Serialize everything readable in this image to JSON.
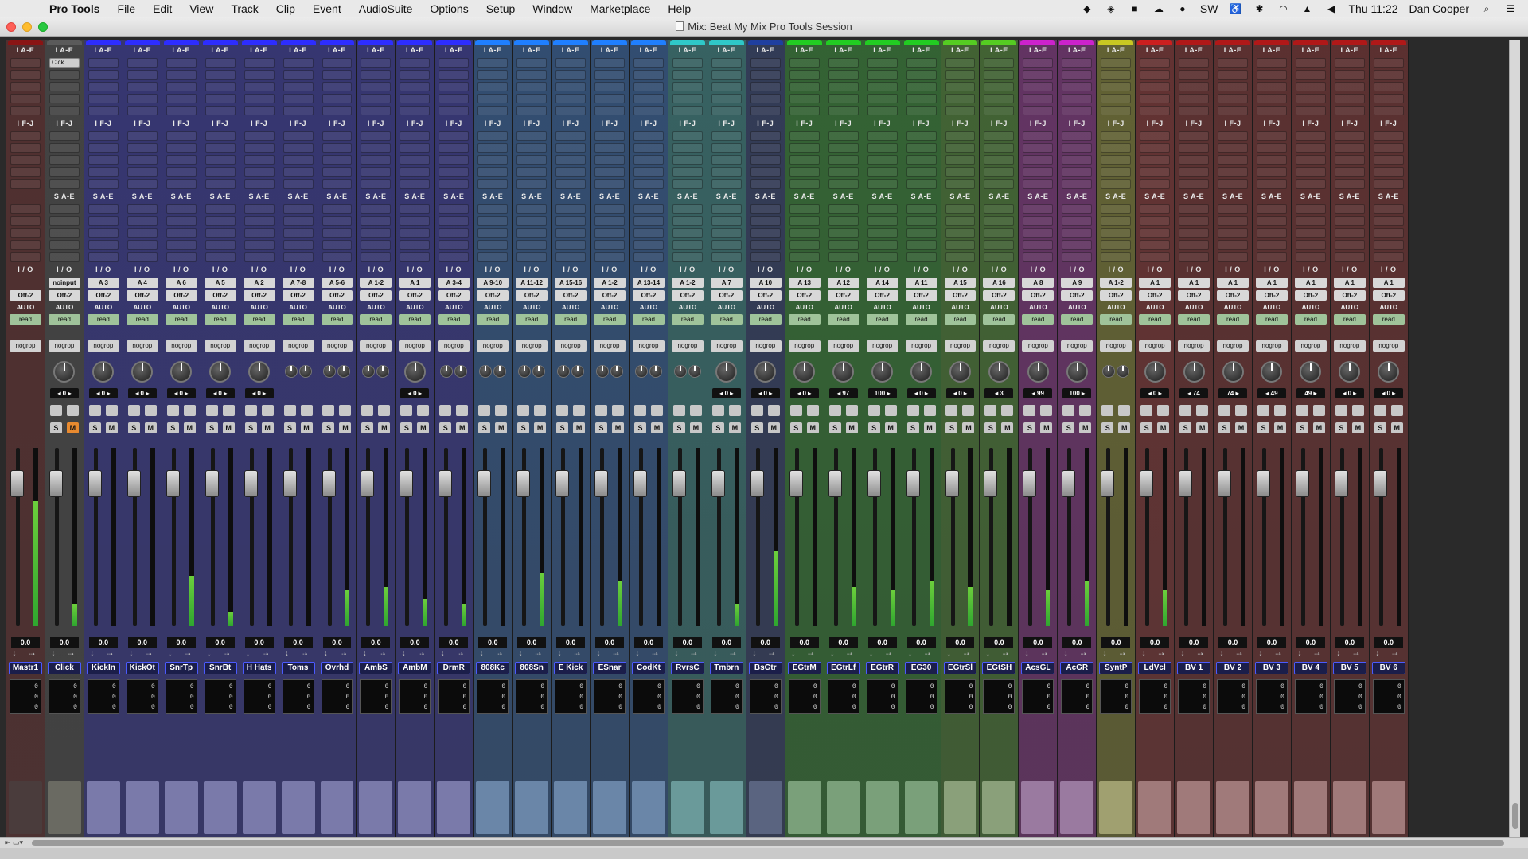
{
  "menubar": {
    "app": "Pro Tools",
    "items": [
      "File",
      "Edit",
      "View",
      "Track",
      "Clip",
      "Event",
      "AudioSuite",
      "Options",
      "Setup",
      "Window",
      "Marketplace",
      "Help"
    ],
    "status_text": "SW",
    "clock": "Thu 11:22",
    "user": "Dan Cooper"
  },
  "window": {
    "title": "Mix: Beat My Mix Pro Tools Session"
  },
  "labels": {
    "inserts_ae": "I A-E",
    "inserts_fj": "I F-J",
    "sends_ae": "S A-E",
    "io": "I / O",
    "output": "Ott-2",
    "auto": "AUTO",
    "read": "read",
    "group": "nogrop",
    "solo": "S",
    "mute": "M",
    "input": "I",
    "click_insert": "Clck",
    "counter_vals": "0"
  },
  "tracks": [
    {
      "name": "Mastr1",
      "color": "#8a1414",
      "io": "",
      "pan": "",
      "vol": "0.0",
      "meter": 0.7,
      "fader": 0.2,
      "comment": "#4a3c3c",
      "master": true
    },
    {
      "name": "Click",
      "color": "#5a5a5a",
      "io": "noinput",
      "pan": "◂ 0 ▸",
      "vol": "0.0",
      "meter": 0.12,
      "fader": 0.2,
      "comment": "#6a6a62",
      "mute_on": true
    },
    {
      "name": "KickIn",
      "color": "#2d2dff",
      "io": "A 3",
      "pan": "◂ 0 ▸",
      "vol": "0.0",
      "meter": 0.0,
      "fader": 0.2,
      "comment": "#7a7aaa"
    },
    {
      "name": "KickOt",
      "color": "#2d2dff",
      "io": "A 4",
      "pan": "◂ 0 ▸",
      "vol": "0.0",
      "meter": 0.0,
      "fader": 0.2,
      "comment": "#7a7aaa"
    },
    {
      "name": "SnrTp",
      "color": "#2d2dff",
      "io": "A 6",
      "pan": "◂ 0 ▸",
      "vol": "0.0",
      "meter": 0.28,
      "fader": 0.2,
      "comment": "#7a7aaa"
    },
    {
      "name": "SnrBt",
      "color": "#2d2dff",
      "io": "A 5",
      "pan": "◂ 0 ▸",
      "vol": "0.0",
      "meter": 0.08,
      "fader": 0.2,
      "comment": "#7a7aaa"
    },
    {
      "name": "H Hats",
      "color": "#2d2dff",
      "io": "A 2",
      "pan": "◂ 0 ▸",
      "vol": "0.0",
      "meter": 0.0,
      "fader": 0.2,
      "comment": "#7a7aaa"
    },
    {
      "name": "Toms",
      "color": "#2d2dff",
      "io": "A 7-8",
      "pan": "",
      "vol": "0.0",
      "meter": 0.0,
      "fader": 0.2,
      "comment": "#7a7aaa",
      "stereo": true
    },
    {
      "name": "Ovrhd",
      "color": "#2d2dff",
      "io": "A 5-6",
      "pan": "",
      "vol": "0.0",
      "meter": 0.2,
      "fader": 0.2,
      "comment": "#7a7aaa",
      "stereo": true
    },
    {
      "name": "AmbS",
      "color": "#2d2dff",
      "io": "A 1-2",
      "pan": "",
      "vol": "0.0",
      "meter": 0.22,
      "fader": 0.2,
      "comment": "#7a7aaa",
      "stereo": true
    },
    {
      "name": "AmbM",
      "color": "#2d2dff",
      "io": "A 1",
      "pan": "◂ 0 ▸",
      "vol": "0.0",
      "meter": 0.15,
      "fader": 0.2,
      "comment": "#7a7aaa"
    },
    {
      "name": "DrmR",
      "color": "#2d2dff",
      "io": "A 3-4",
      "pan": "",
      "vol": "0.0",
      "meter": 0.12,
      "fader": 0.2,
      "comment": "#7a7aaa",
      "stereo": true
    },
    {
      "name": "808Kc",
      "color": "#1f7fff",
      "io": "A 9-10",
      "pan": "",
      "vol": "0.0",
      "meter": 0.0,
      "fader": 0.2,
      "comment": "#6a86a8",
      "stereo": true
    },
    {
      "name": "808Sn",
      "color": "#1f7fff",
      "io": "A 11-12",
      "pan": "",
      "vol": "0.0",
      "meter": 0.3,
      "fader": 0.2,
      "comment": "#6a86a8",
      "stereo": true
    },
    {
      "name": "E Kick",
      "color": "#1f7fff",
      "io": "A 15-16",
      "pan": "",
      "vol": "0.0",
      "meter": 0.0,
      "fader": 0.2,
      "comment": "#6a86a8",
      "stereo": true
    },
    {
      "name": "ESnar",
      "color": "#1f7fff",
      "io": "A 1-2",
      "pan": "",
      "vol": "0.0",
      "meter": 0.25,
      "fader": 0.2,
      "comment": "#6a86a8",
      "stereo": true
    },
    {
      "name": "CodKt",
      "color": "#1f7fff",
      "io": "A 13-14",
      "pan": "",
      "vol": "0.0",
      "meter": 0.0,
      "fader": 0.2,
      "comment": "#6a86a8",
      "stereo": true
    },
    {
      "name": "RvrsC",
      "color": "#2fc8c8",
      "io": "A 1-2",
      "pan": "",
      "vol": "0.0",
      "meter": 0.0,
      "fader": 0.2,
      "comment": "#6a9a9a",
      "stereo": true
    },
    {
      "name": "Tmbrn",
      "color": "#2fc8c8",
      "io": "A 7",
      "pan": "◂ 0 ▸",
      "vol": "0.0",
      "meter": 0.12,
      "fader": 0.2,
      "comment": "#6a9a9a"
    },
    {
      "name": "BsGtr",
      "color": "#1f3f9f",
      "io": "A 10",
      "pan": "◂ 0 ▸",
      "vol": "0.0",
      "meter": 0.42,
      "fader": 0.2,
      "comment": "#5a6480"
    },
    {
      "name": "EGtrM",
      "color": "#22cc22",
      "io": "A 13",
      "pan": "◂ 0 ▸",
      "vol": "0.0",
      "meter": 0.0,
      "fader": 0.2,
      "comment": "#7aa07a"
    },
    {
      "name": "EGtrLf",
      "color": "#22cc22",
      "io": "A 12",
      "pan": "◂ 97",
      "vol": "0.0",
      "meter": 0.22,
      "fader": 0.2,
      "comment": "#7aa07a"
    },
    {
      "name": "EGtrR",
      "color": "#22cc22",
      "io": "A 14",
      "pan": "100 ▸",
      "vol": "0.0",
      "meter": 0.2,
      "fader": 0.2,
      "comment": "#7aa07a"
    },
    {
      "name": "EG30",
      "color": "#22cc22",
      "io": "A 11",
      "pan": "◂ 0 ▸",
      "vol": "0.0",
      "meter": 0.25,
      "fader": 0.2,
      "comment": "#7aa07a"
    },
    {
      "name": "EGtrSl",
      "color": "#55cc22",
      "io": "A 15",
      "pan": "◂ 0 ▸",
      "vol": "0.0",
      "meter": 0.22,
      "fader": 0.2,
      "comment": "#8aa07a"
    },
    {
      "name": "EGtSH",
      "color": "#55cc22",
      "io": "A 16",
      "pan": "◂ 3",
      "vol": "0.0",
      "meter": 0.0,
      "fader": 0.2,
      "comment": "#8aa07a"
    },
    {
      "name": "AcsGL",
      "color": "#cc22cc",
      "io": "A 8",
      "pan": "◂ 99",
      "vol": "0.0",
      "meter": 0.2,
      "fader": 0.2,
      "comment": "#9a7aa0"
    },
    {
      "name": "AcGR",
      "color": "#cc22cc",
      "io": "A 9",
      "pan": "100 ▸",
      "vol": "0.0",
      "meter": 0.25,
      "fader": 0.2,
      "comment": "#9a7aa0"
    },
    {
      "name": "SyntP",
      "color": "#c8c822",
      "io": "A 1-2",
      "pan": "",
      "vol": "0.0",
      "meter": 0.0,
      "fader": 0.2,
      "comment": "#a0a070",
      "stereo": true
    },
    {
      "name": "LdVcl",
      "color": "#cc1f1f",
      "io": "A 1",
      "pan": "◂ 0 ▸",
      "vol": "0.0",
      "meter": 0.2,
      "fader": 0.2,
      "comment": "#a07a7a"
    },
    {
      "name": "BV 1",
      "color": "#b01818",
      "io": "A 1",
      "pan": "◂ 74",
      "vol": "0.0",
      "meter": 0.0,
      "fader": 0.2,
      "comment": "#a07a7a"
    },
    {
      "name": "BV 2",
      "color": "#b01818",
      "io": "A 1",
      "pan": "74 ▸",
      "vol": "0.0",
      "meter": 0.0,
      "fader": 0.2,
      "comment": "#a07a7a"
    },
    {
      "name": "BV 3",
      "color": "#b01818",
      "io": "A 1",
      "pan": "◂ 49",
      "vol": "0.0",
      "meter": 0.0,
      "fader": 0.2,
      "comment": "#a07a7a"
    },
    {
      "name": "BV 4",
      "color": "#b01818",
      "io": "A 1",
      "pan": "49 ▸",
      "vol": "0.0",
      "meter": 0.0,
      "fader": 0.2,
      "comment": "#a07a7a"
    },
    {
      "name": "BV 5",
      "color": "#b01818",
      "io": "A 1",
      "pan": "◂ 0 ▸",
      "vol": "0.0",
      "meter": 0.0,
      "fader": 0.2,
      "comment": "#a07a7a"
    },
    {
      "name": "BV 6",
      "color": "#b01818",
      "io": "A 1",
      "pan": "◂ 0 ▸",
      "vol": "0.0",
      "meter": 0.0,
      "fader": 0.2,
      "comment": "#a07a7a"
    }
  ]
}
